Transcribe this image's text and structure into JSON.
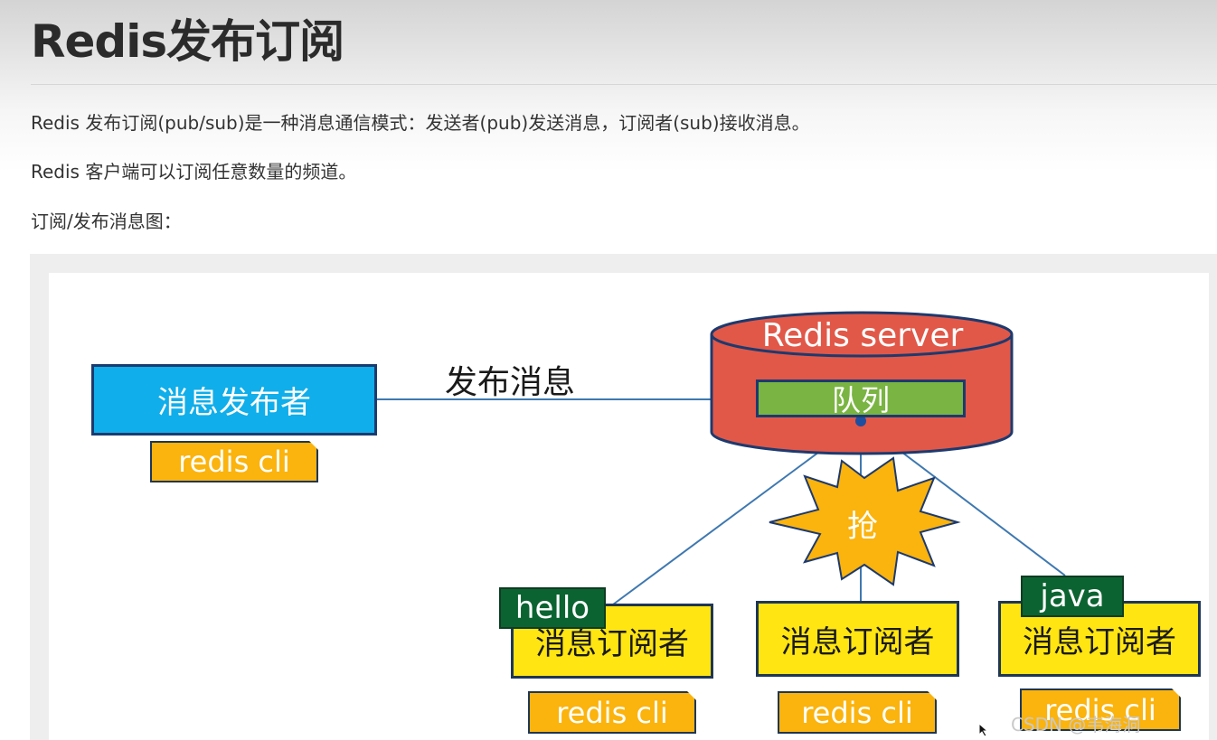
{
  "page": {
    "title": "Redis发布订阅",
    "paragraphs": [
      "Redis 发布订阅(pub/sub)是一种消息通信模式：发送者(pub)发送消息，订阅者(sub)接收消息。",
      "Redis 客户端可以订阅任意数量的频道。",
      "订阅/发布消息图："
    ]
  },
  "diagram": {
    "publisher_label": "消息发布者",
    "publisher_cli": "redis cli",
    "publish_label": "发布消息",
    "server_label": "Redis server",
    "queue_label": "队列",
    "grab_label": "抢",
    "subscribers": [
      {
        "label": "消息订阅者",
        "cli": "redis cli",
        "message": "hello"
      },
      {
        "label": "消息订阅者",
        "cli": "redis cli"
      },
      {
        "label": "消息订阅者",
        "cli": "redis cli",
        "message": "java"
      }
    ],
    "colors": {
      "publisher": "#10aeea",
      "cli": "#fbb30d",
      "subscriber": "#ffe511",
      "message_tag": "#0b6331",
      "server": "#e15848",
      "queue": "#7ab442",
      "grab_burst": "#fbb30d"
    }
  },
  "watermark": "CSDN @韦海洞"
}
